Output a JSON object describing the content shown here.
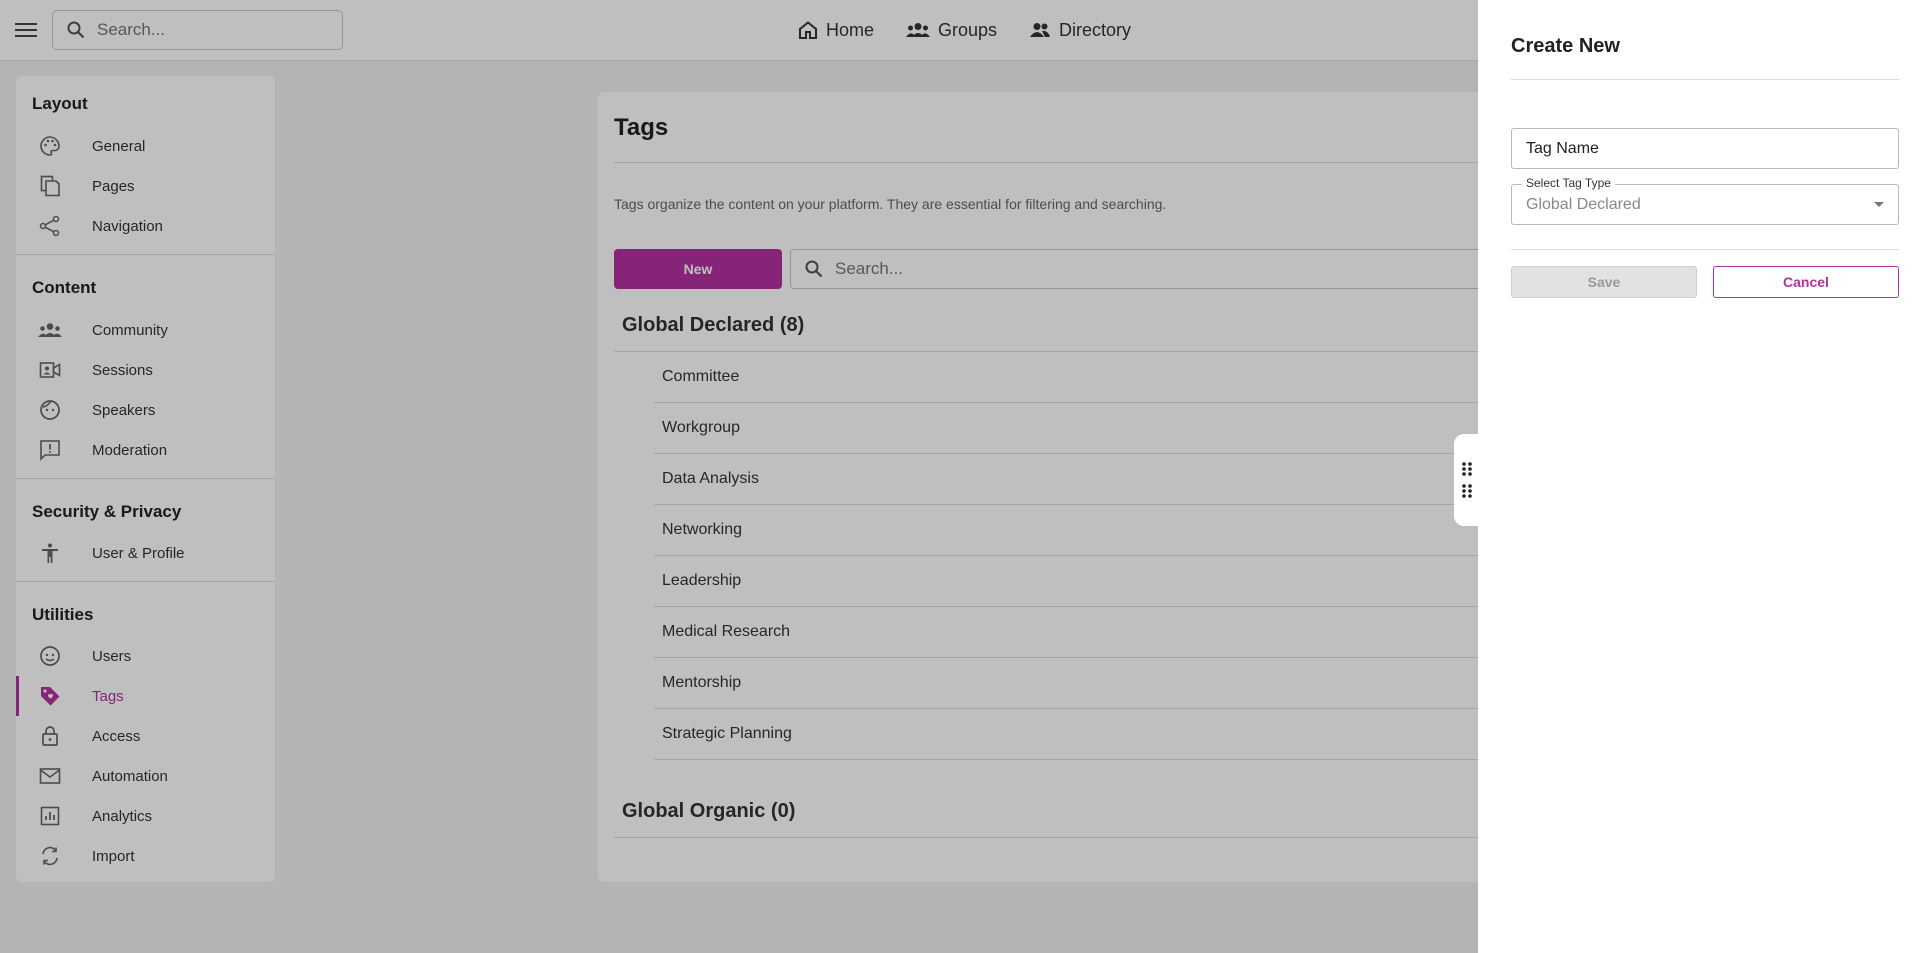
{
  "topbar": {
    "search_placeholder": "Search...",
    "nav": [
      {
        "label": "Home",
        "icon": "home-icon"
      },
      {
        "label": "Groups",
        "icon": "groups-icon"
      },
      {
        "label": "Directory",
        "icon": "directory-icon"
      }
    ]
  },
  "sidebar": {
    "sections": [
      {
        "title": "Layout",
        "items": [
          {
            "label": "General",
            "icon": "palette-icon"
          },
          {
            "label": "Pages",
            "icon": "pages-icon"
          },
          {
            "label": "Navigation",
            "icon": "share-icon"
          }
        ]
      },
      {
        "title": "Content",
        "items": [
          {
            "label": "Community",
            "icon": "community-icon"
          },
          {
            "label": "Sessions",
            "icon": "video-icon"
          },
          {
            "label": "Speakers",
            "icon": "speaker-face-icon"
          },
          {
            "label": "Moderation",
            "icon": "moderation-icon"
          }
        ]
      },
      {
        "title": "Security & Privacy",
        "items": [
          {
            "label": "User & Profile",
            "icon": "accessibility-icon"
          }
        ]
      },
      {
        "title": "Utilities",
        "items": [
          {
            "label": "Users",
            "icon": "face-icon"
          },
          {
            "label": "Tags",
            "icon": "tag-icon",
            "active": true
          },
          {
            "label": "Access",
            "icon": "lock-icon"
          },
          {
            "label": "Automation",
            "icon": "mail-icon"
          },
          {
            "label": "Analytics",
            "icon": "analytics-icon"
          },
          {
            "label": "Import",
            "icon": "sync-icon"
          }
        ]
      }
    ]
  },
  "main": {
    "title": "Tags",
    "description": "Tags organize the content on your platform. They are essential for filtering and searching.",
    "new_button": "New",
    "search_placeholder": "Search...",
    "groups": [
      {
        "title": "Global Declared (8)",
        "tags": [
          "Committee",
          "Workgroup",
          "Data Analysis",
          "Networking",
          "Leadership",
          "Medical Research",
          "Mentorship",
          "Strategic Planning"
        ]
      },
      {
        "title": "Global Organic (0)",
        "tags": []
      }
    ]
  },
  "drawer": {
    "title": "Create New",
    "tag_name_value": "Tag Name",
    "tag_type_label": "Select Tag Type",
    "tag_type_value": "Global Declared",
    "save_label": "Save",
    "cancel_label": "Cancel"
  },
  "colors": {
    "accent": "#b3309f",
    "background": "#f0f0f0",
    "surface": "#ffffff"
  }
}
